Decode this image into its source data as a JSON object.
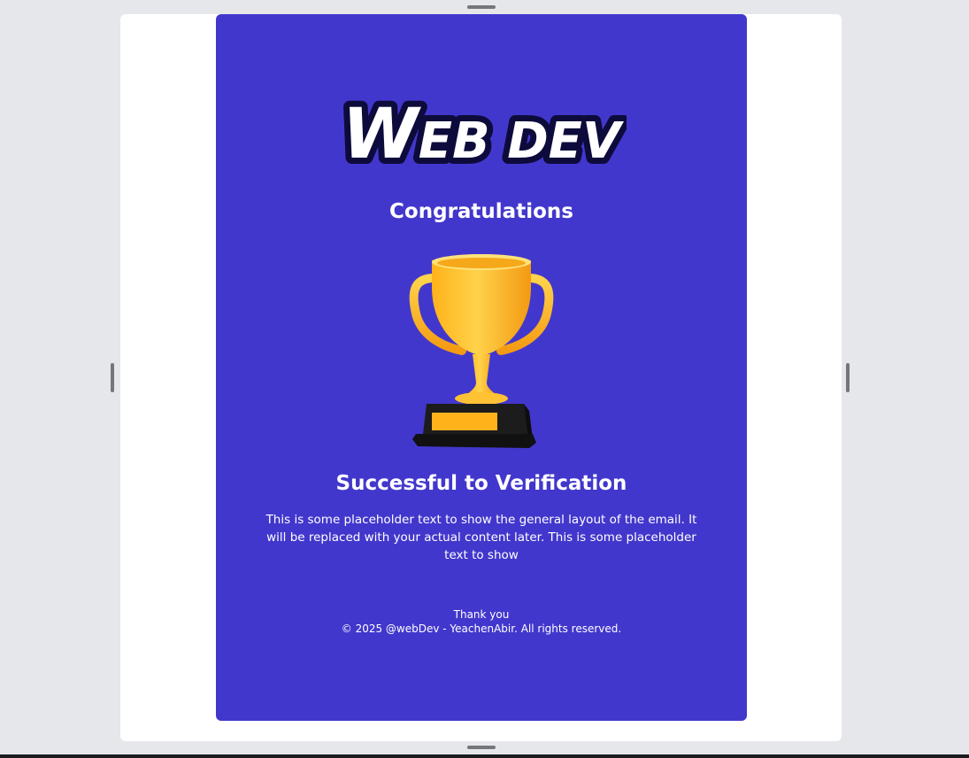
{
  "email": {
    "logo_text": "WEB DEV",
    "title": "Congratulations",
    "heading": "Successful to Verification",
    "body": "This is some placeholder text to show the general layout of the email. It will be replaced with your actual content later. This is some placeholder text to show",
    "thanks": "Thank you",
    "copyright": "© 2025 @webDev - YeachenAbir. All rights reserved."
  },
  "colors": {
    "workspace_bg": "#e6e7eb",
    "canvas_bg": "#ffffff",
    "card_bg": "#4237cc",
    "trophy_gold": "#f7b21c",
    "trophy_base": "#1a1a1a"
  },
  "icons": {
    "trophy": "trophy-icon",
    "resize_handles": "resize-handle-icon"
  }
}
